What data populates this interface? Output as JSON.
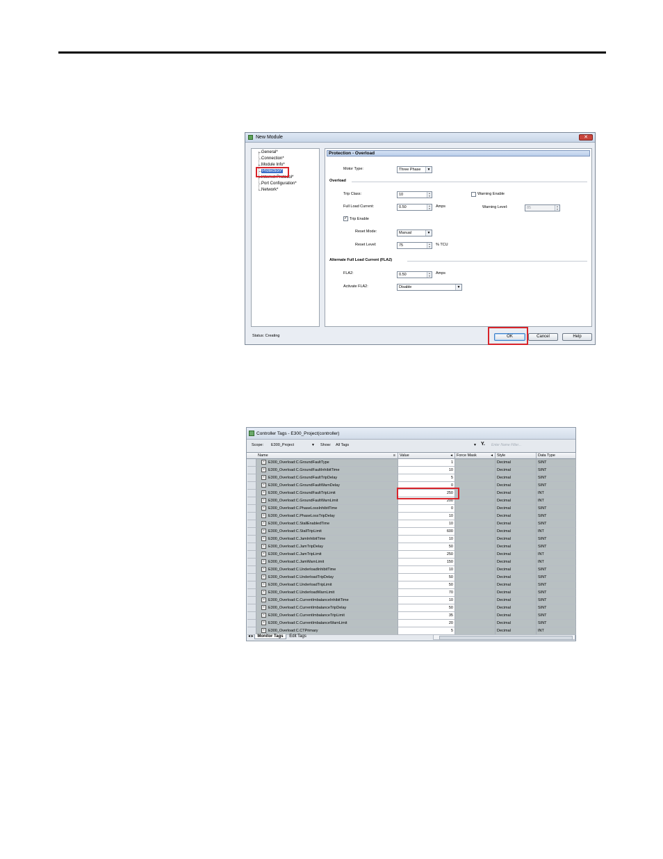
{
  "dialog1": {
    "title": "New Module",
    "tree": [
      "General*",
      "Connection*",
      "Module Info*",
      "Protection*",
      "Internet Protocol*",
      "Port Configuration*",
      "Network*"
    ],
    "panel_title": "Protection - Overload",
    "motor_type_label": "Motor Type:",
    "motor_type_value": "Three Phase",
    "overload_section": "Overload",
    "trip_class_label": "Trip Class:",
    "trip_class_value": "10",
    "warning_enable_label": "Warning Enable",
    "flc_label": "Full Load Current:",
    "flc_value": "0.50",
    "flc_unit": "Amps",
    "warning_level_label": "Warning Level:",
    "warning_level_value": "85",
    "trip_enable_label": "Trip Enable",
    "reset_mode_label": "Reset Mode:",
    "reset_mode_value": "Manual",
    "reset_level_label": "Reset Level:",
    "reset_level_value": "75",
    "reset_level_unit": "% TCU",
    "fla2_section": "Alternate Full Load Current (FLA2)",
    "fla2_label": "FLA2:",
    "fla2_value": "0.50",
    "fla2_unit": "Amps",
    "activate_fla2_label": "Activate FLA2:",
    "activate_fla2_value": "Disable",
    "status_text": "Status: Creating",
    "ok_label": "OK",
    "cancel_label": "Cancel",
    "help_label": "Help"
  },
  "dialog2": {
    "title": "Controller Tags - E300_Project(controller)",
    "scope_label": "Scope:",
    "scope_value": "E300_Project",
    "show_label": "Show:",
    "show_value": "All Tags",
    "filter_placeholder": "Enter Name Filter...",
    "headers": [
      "Name",
      "Value",
      "Force Mask",
      "Style",
      "Data Type"
    ],
    "rows": [
      {
        "name": "E300_Overload:C.GroundFaultType",
        "value": "1",
        "style": "Decimal",
        "type": "SINT"
      },
      {
        "name": "E300_Overload:C.GroundFaultInhibitTime",
        "value": "10",
        "style": "Decimal",
        "type": "SINT"
      },
      {
        "name": "E300_Overload:C.GroundFaultTripDelay",
        "value": "5",
        "style": "Decimal",
        "type": "SINT"
      },
      {
        "name": "E300_Overload:C.GroundFaultWarnDelay",
        "value": "0",
        "style": "Decimal",
        "type": "SINT"
      },
      {
        "name": "E300_Overload:C.GroundFaultTripLimit",
        "value": "250",
        "style": "Decimal",
        "type": "INT"
      },
      {
        "name": "E300_Overload:C.GroundFaultWarnLimit",
        "value": "200",
        "style": "Decimal",
        "type": "INT"
      },
      {
        "name": "E300_Overload:C.PhaseLossInhibitTime",
        "value": "0",
        "style": "Decimal",
        "type": "SINT"
      },
      {
        "name": "E300_Overload:C.PhaseLossTripDelay",
        "value": "10",
        "style": "Decimal",
        "type": "SINT"
      },
      {
        "name": "E300_Overload:C.StallEnabledTime",
        "value": "10",
        "style": "Decimal",
        "type": "SINT"
      },
      {
        "name": "E300_Overload:C.StallTripLimit",
        "value": "600",
        "style": "Decimal",
        "type": "INT"
      },
      {
        "name": "E300_Overload:C.JamInhibitTime",
        "value": "10",
        "style": "Decimal",
        "type": "SINT"
      },
      {
        "name": "E300_Overload:C.JamTripDelay",
        "value": "50",
        "style": "Decimal",
        "type": "SINT"
      },
      {
        "name": "E300_Overload:C.JamTripLimit",
        "value": "250",
        "style": "Decimal",
        "type": "INT"
      },
      {
        "name": "E300_Overload:C.JamWarnLimit",
        "value": "150",
        "style": "Decimal",
        "type": "INT"
      },
      {
        "name": "E300_Overload:C.UnderloadInhibitTime",
        "value": "10",
        "style": "Decimal",
        "type": "SINT"
      },
      {
        "name": "E300_Overload:C.UnderloadTripDelay",
        "value": "50",
        "style": "Decimal",
        "type": "SINT"
      },
      {
        "name": "E300_Overload:C.UnderloadTripLimit",
        "value": "50",
        "style": "Decimal",
        "type": "SINT"
      },
      {
        "name": "E300_Overload:C.UnderloadWarnLimit",
        "value": "70",
        "style": "Decimal",
        "type": "SINT"
      },
      {
        "name": "E300_Overload:C.CurrentImbalanceInhibitTime",
        "value": "10",
        "style": "Decimal",
        "type": "SINT"
      },
      {
        "name": "E300_Overload:C.CurrentImbalanceTripDelay",
        "value": "50",
        "style": "Decimal",
        "type": "SINT"
      },
      {
        "name": "E300_Overload:C.CurrentImbalanceTripLimit",
        "value": "35",
        "style": "Decimal",
        "type": "SINT"
      },
      {
        "name": "E300_Overload:C.CurrentImbalanceWarnLimit",
        "value": "20",
        "style": "Decimal",
        "type": "SINT"
      },
      {
        "name": "E300_Overload:C.CTPrimary",
        "value": "5",
        "style": "Decimal",
        "type": "INT"
      }
    ],
    "tab_monitor": "Monitor Tags",
    "tab_edit": "Edit Tags"
  }
}
